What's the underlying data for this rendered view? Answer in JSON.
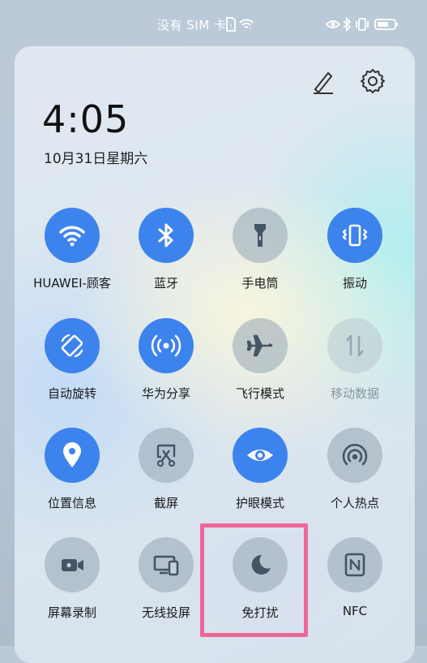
{
  "status_bar": {
    "carrier": "没有 SIM 卡",
    "icons": [
      "sim-card-icon",
      "wifi-icon",
      "eye-icon",
      "bluetooth-icon",
      "vibrate-icon",
      "battery-icon"
    ]
  },
  "header": {
    "time": "4:05",
    "date": "10月31日星期六",
    "edit_icon": "pencil-icon",
    "settings_icon": "gear-icon"
  },
  "toggles": [
    {
      "label": "HUAWEI-顾客",
      "icon": "wifi-icon",
      "active": true
    },
    {
      "label": "蓝牙",
      "icon": "bluetooth-icon",
      "active": true
    },
    {
      "label": "手电筒",
      "icon": "flashlight-icon",
      "active": false
    },
    {
      "label": "振动",
      "icon": "vibrate-icon",
      "active": true
    },
    {
      "label": "自动旋转",
      "icon": "auto-rotate-icon",
      "active": true
    },
    {
      "label": "华为分享",
      "icon": "huawei-share-icon",
      "active": true
    },
    {
      "label": "飞行模式",
      "icon": "airplane-icon",
      "active": false
    },
    {
      "label": "移动数据",
      "icon": "mobile-data-icon",
      "active": false,
      "disabled": true
    },
    {
      "label": "位置信息",
      "icon": "location-icon",
      "active": true
    },
    {
      "label": "截屏",
      "icon": "screenshot-icon",
      "active": false
    },
    {
      "label": "护眼模式",
      "icon": "eye-comfort-icon",
      "active": true
    },
    {
      "label": "个人热点",
      "icon": "hotspot-icon",
      "active": false
    },
    {
      "label": "屏幕录制",
      "icon": "screen-record-icon",
      "active": false
    },
    {
      "label": "无线投屏",
      "icon": "wireless-projection-icon",
      "active": false
    },
    {
      "label": "免打扰",
      "icon": "moon-icon",
      "active": false,
      "highlighted": true
    },
    {
      "label": "NFC",
      "icon": "nfc-icon",
      "active": false
    }
  ],
  "colors": {
    "accent": "#3d83ee",
    "inactive": "#96a5b4",
    "highlight_border": "#f06597"
  }
}
